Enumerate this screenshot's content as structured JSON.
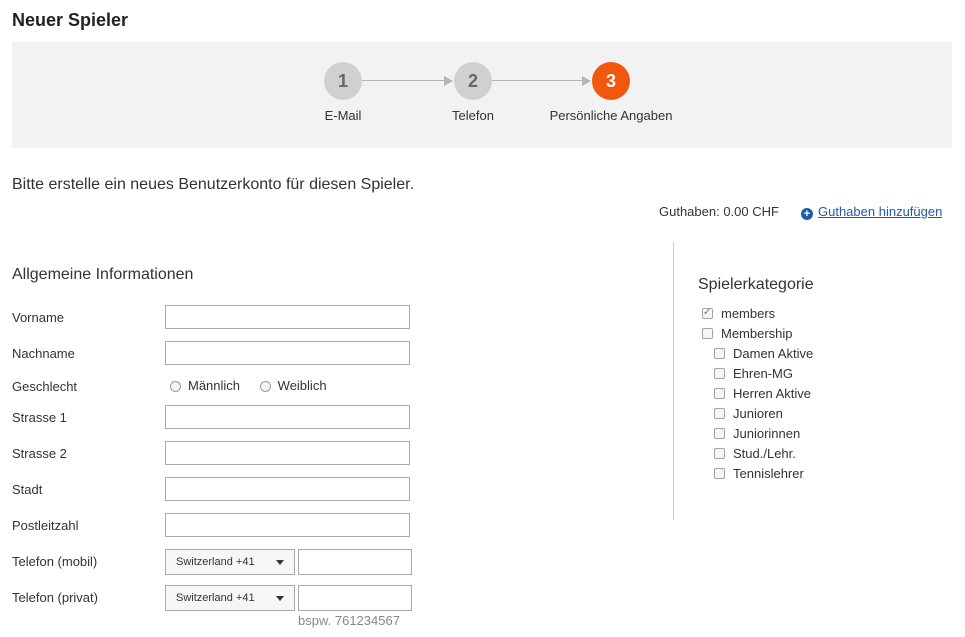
{
  "page_title": "Neuer Spieler",
  "steps": [
    {
      "number": "1",
      "label": "E-Mail"
    },
    {
      "number": "2",
      "label": "Telefon"
    },
    {
      "number": "3",
      "label": "Persönliche Angaben"
    }
  ],
  "intro_text": "Bitte erstelle ein neues Benutzerkonto für diesen Spieler.",
  "balance_text": "Guthaben: 0.00 CHF",
  "add_credit_label": "Guthaben hinzufügen",
  "general": {
    "title": "Allgemeine Informationen",
    "labels": {
      "first_name": "Vorname",
      "last_name": "Nachname",
      "gender": "Geschlecht",
      "street1": "Strasse 1",
      "street2": "Strasse 2",
      "city": "Stadt",
      "zip": "Postleitzahl",
      "phone_mobile": "Telefon (mobil)",
      "phone_private": "Telefon (privat)"
    },
    "gender_options": [
      "Männlich",
      "Weiblich"
    ],
    "country_code": "Switzerland +41",
    "phone_hint": "bspw. 761234567"
  },
  "categories": {
    "title": "Spielerkategorie",
    "items": [
      {
        "label": "members",
        "checked": true
      },
      {
        "label": "Membership",
        "checked": false
      },
      {
        "label": "Damen Aktive",
        "checked": false
      },
      {
        "label": "Ehren-MG",
        "checked": false
      },
      {
        "label": "Herren Aktive",
        "checked": false
      },
      {
        "label": "Junioren",
        "checked": false
      },
      {
        "label": "Juniorinnen",
        "checked": false
      },
      {
        "label": "Stud./Lehr.",
        "checked": false
      },
      {
        "label": "Tennislehrer",
        "checked": false
      }
    ]
  },
  "colors": {
    "accent": "#f2570e",
    "link": "#1f5ca8",
    "step_inactive": "#d0d0d0"
  }
}
